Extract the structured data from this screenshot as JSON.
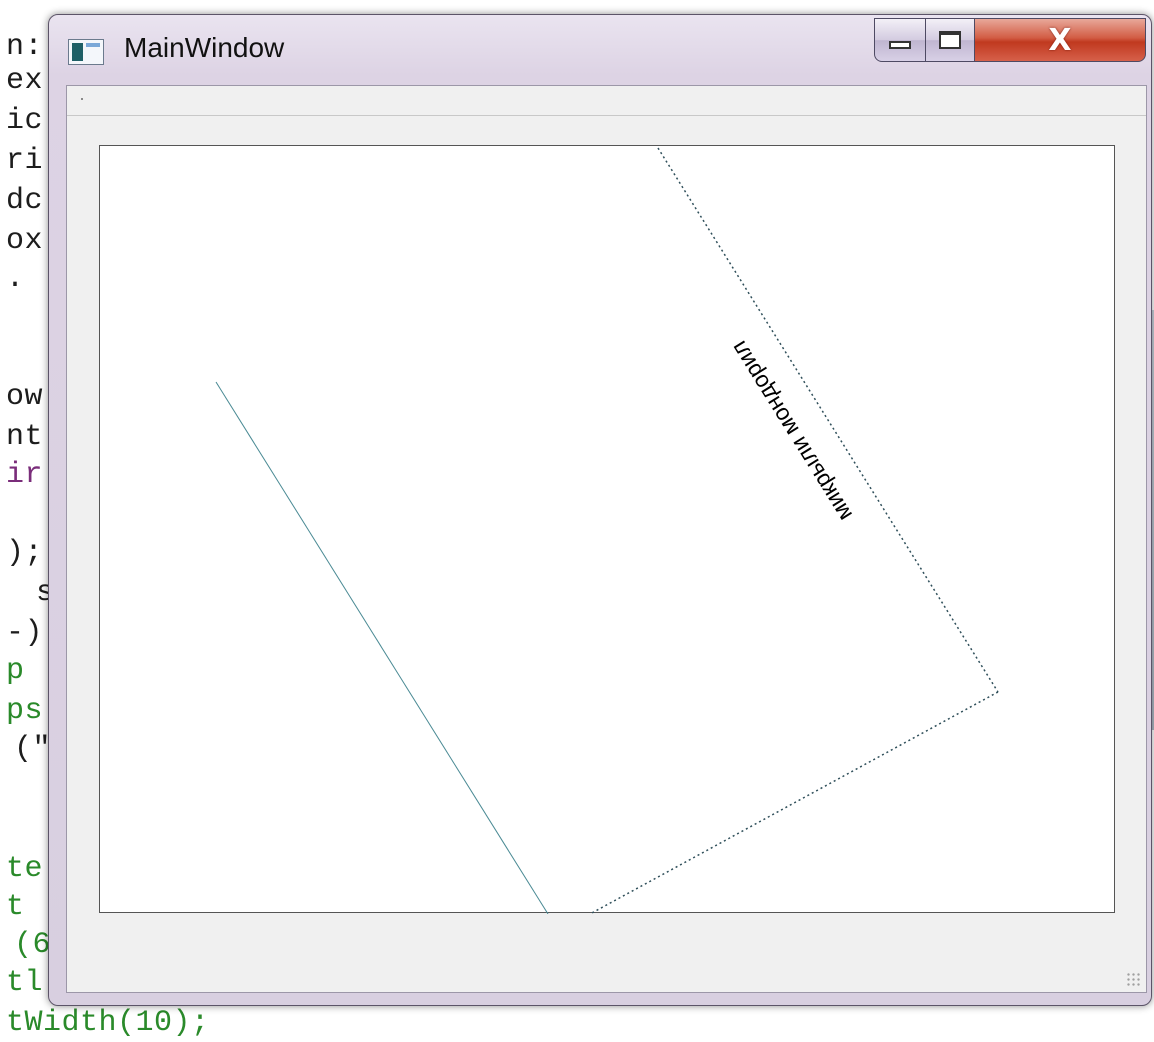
{
  "window": {
    "title": "MainWindow",
    "icon": "app-window-icon",
    "controls": {
      "minimize_icon": "minimize-icon",
      "maximize_icon": "maximize-icon",
      "close_label": "X"
    }
  },
  "canvas": {
    "rotated_text": "микрыли мондорил"
  },
  "background_editor": {
    "fragments": [
      "n:",
      "ex",
      "ic",
      "ri",
      "dc",
      "ox",
      ".",
      "ow",
      "nt",
      "ir",
      ");",
      "s",
      "-)",
      "p",
      "ps",
      "(\"",
      "te",
      "t",
      "(6",
      "tl",
      "tWidth(10);"
    ]
  },
  "colors": {
    "title_bar": "#ddd3e4",
    "close_button": "#c0391f",
    "canvas_bg": "#ffffff",
    "line_color": "#2f6e78",
    "editor_green": "#2a8a2a"
  }
}
